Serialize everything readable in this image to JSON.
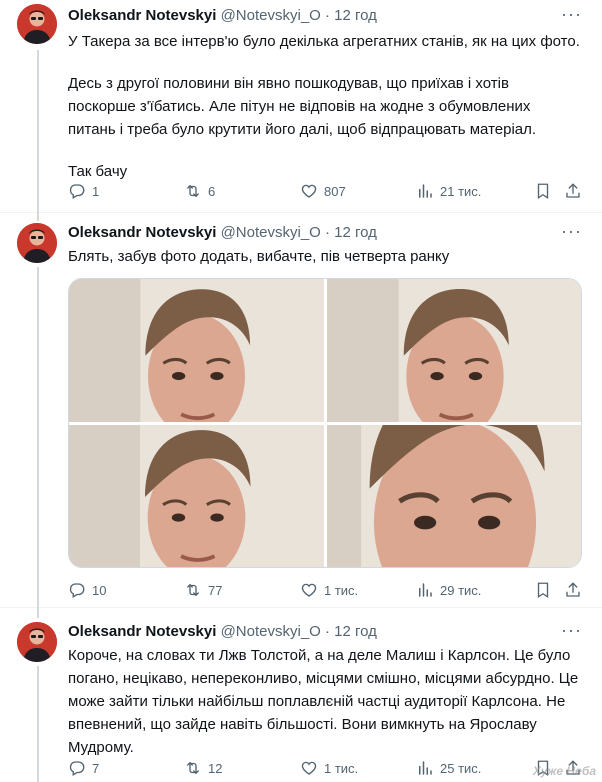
{
  "tweets": [
    {
      "author": "Oleksandr Notevskyi",
      "handle": "@Notevskyi_O",
      "time": "· 12 год",
      "text": [
        "У Такера за все інтерв'ю було декілька агрегатних станів, як на цих фото.",
        "",
        "Десь з другої половини він явно пошкодував, що приїхав і хотів поскорше з'їбатись. Але пітун не відповів на жодне з обумовлених питань і треба було крутити його далі, щоб відпрацювать матеріал.",
        "",
        "Так бачу"
      ],
      "replies": "1",
      "reposts": "6",
      "likes": "807",
      "views": "21 тис."
    },
    {
      "author": "Oleksandr Notevskyi",
      "handle": "@Notevskyi_O",
      "time": "· 12 год",
      "text": [
        "Блять, забув фото додать, вибачте, пів четверта ранку"
      ],
      "replies": "10",
      "reposts": "77",
      "likes": "1 тис.",
      "views": "29 тис."
    },
    {
      "author": "Oleksandr Notevskyi",
      "handle": "@Notevskyi_O",
      "time": "· 12 год",
      "text": [
        "Короче, на словах ти Лжв Толстой, а на деле Малиш і Карлсон. Це було погано, нецікаво, непереконливо, місцями смішно, місцями абсурдно. Це може зайти тільки найбільш поплавлєній частці аудиторії Карлсона. Не впевнений, що зайде навіть більшості. Вони вимкнуть на Ярославу Мудрому."
      ],
      "replies": "7",
      "reposts": "12",
      "likes": "1 тис.",
      "views": "25 тис."
    }
  ],
  "icons": {
    "reply": "reply-icon",
    "repost": "repost-icon",
    "like": "heart-icon",
    "views": "views-icon",
    "bookmark": "bookmark-icon",
    "share": "share-icon",
    "more": "more-icon"
  },
  "watermark": "Хуже Неба",
  "colors": {
    "text": "#0f1419",
    "secondary": "#536471",
    "border": "#eff3f4",
    "thread_line": "#cfd9de"
  }
}
